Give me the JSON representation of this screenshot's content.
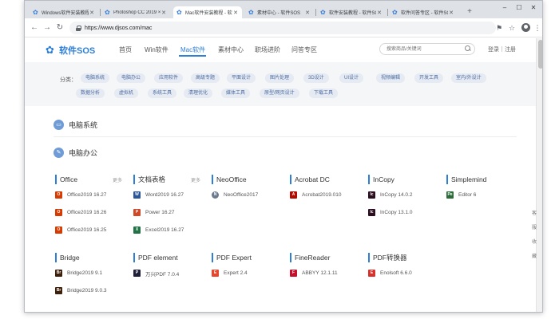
{
  "browser": {
    "tabs": [
      {
        "label": "Windows软件安装教程 - 软"
      },
      {
        "label": "Photoshop CC 2019 ×"
      },
      {
        "label": "Mac软件安装教程 - 软件SO"
      },
      {
        "label": "素材中心 - 软件SOS"
      },
      {
        "label": "软件安装教程 - 软件SO"
      },
      {
        "label": "软件问答专区 - 软件SOS"
      }
    ],
    "active_tab_index": 2,
    "url": "https://www.djsos.com/mac",
    "window_controls": {
      "minimize": "–",
      "maximize": "☐",
      "close": "✕"
    }
  },
  "site": {
    "logo_text": "软件SOS",
    "nav": [
      {
        "label": "首页"
      },
      {
        "label": "Win软件"
      },
      {
        "label": "Mac软件"
      },
      {
        "label": "素材中心"
      },
      {
        "label": "职场进阶"
      },
      {
        "label": "问答专区"
      }
    ],
    "search_placeholder": "搜索商品/关键词",
    "auth_text": "登录｜注册"
  },
  "categories": {
    "label": "分类：",
    "chips": [
      "电脑系统",
      "电脑办公",
      "应用软件",
      "高级专题",
      "平面设计",
      "图片处理",
      "3D设计",
      "UI设计",
      "视频编辑",
      "开发工具",
      "室内/外设计",
      "数据分析",
      "虚拟机",
      "系统工具",
      "清理优化",
      "媒体工具",
      "原型/网页设计",
      "下载工具"
    ]
  },
  "sections": [
    {
      "title": "电脑系统"
    },
    {
      "title": "电脑办公"
    }
  ],
  "columns": [
    {
      "title": "Office",
      "more": "更多",
      "items": [
        {
          "name": "Office2019 16.27",
          "icon": "office-icon",
          "color": "#d83b01",
          "glyph": "O"
        },
        {
          "name": "Office2019 16.26",
          "icon": "office-icon",
          "color": "#d83b01",
          "glyph": "O"
        },
        {
          "name": "Office2019 16.25",
          "icon": "office-icon",
          "color": "#d83b01",
          "glyph": "O"
        }
      ]
    },
    {
      "title": "文档表格",
      "more": "更多",
      "items": [
        {
          "name": "Word2019 16.27",
          "icon": "word-icon",
          "color": "#2b579a",
          "glyph": "W"
        },
        {
          "name": "Power 16.27",
          "icon": "powerpoint-icon",
          "color": "#d24726",
          "glyph": "P"
        },
        {
          "name": "Excel2019 16.27",
          "icon": "excel-icon",
          "color": "#217346",
          "glyph": "X"
        }
      ]
    },
    {
      "title": "NeoOffice",
      "more": "",
      "items": [
        {
          "name": "NeoOffice2017",
          "icon": "neooffice-icon",
          "color": "#6b7a8f",
          "glyph": "N"
        }
      ]
    },
    {
      "title": "Acrobat DC",
      "more": "",
      "items": [
        {
          "name": "Acrobat2019.010",
          "icon": "acrobat-icon",
          "color": "#b30b00",
          "glyph": "A"
        }
      ]
    },
    {
      "title": "InCopy",
      "more": "",
      "items": [
        {
          "name": "InCopy 14.0.2",
          "icon": "incopy-icon",
          "color": "#2a0d1f",
          "glyph": "Ic"
        },
        {
          "name": "InCopy 13.1.0",
          "icon": "incopy-icon",
          "color": "#2a0d1f",
          "glyph": "Ic"
        }
      ]
    },
    {
      "title": "Simplemind",
      "more": "",
      "items": [
        {
          "name": "Editor 6",
          "icon": "simplemind-icon",
          "color": "#2e6b3a",
          "glyph": "Pe"
        }
      ]
    },
    {
      "title": "Bridge",
      "more": "",
      "items": [
        {
          "name": "Bridge2019 9.1",
          "icon": "bridge-icon",
          "color": "#3d1f0a",
          "glyph": "Br"
        },
        {
          "name": "Bridge2019 9.0.3",
          "icon": "bridge-icon",
          "color": "#3d1f0a",
          "glyph": "Br"
        }
      ]
    },
    {
      "title": "PDF element",
      "more": "",
      "items": [
        {
          "name": "万兴PDF 7.0.4",
          "icon": "pdfelement-icon",
          "color": "#1f1f3a",
          "glyph": "P"
        }
      ]
    },
    {
      "title": "PDF Expert",
      "more": "",
      "items": [
        {
          "name": "Expert 2.4",
          "icon": "pdfexpert-icon",
          "color": "#e8452c",
          "glyph": "E"
        }
      ]
    },
    {
      "title": "FineReader",
      "more": "",
      "items": [
        {
          "name": "ABBYY 12.1.11",
          "icon": "finereader-icon",
          "color": "#c8102e",
          "glyph": "F"
        }
      ]
    },
    {
      "title": "PDF转换器",
      "more": "",
      "items": [
        {
          "name": "Enolsoft 6.6.0",
          "icon": "pdf-converter-icon",
          "color": "#d9302c",
          "glyph": "E"
        }
      ]
    }
  ],
  "side_tools": [
    "客",
    "服",
    "收",
    "藏"
  ],
  "colors": {
    "accent": "#2e7fd8",
    "chip_bg": "#e6eaf2",
    "chip_text": "#4d6ea3"
  }
}
